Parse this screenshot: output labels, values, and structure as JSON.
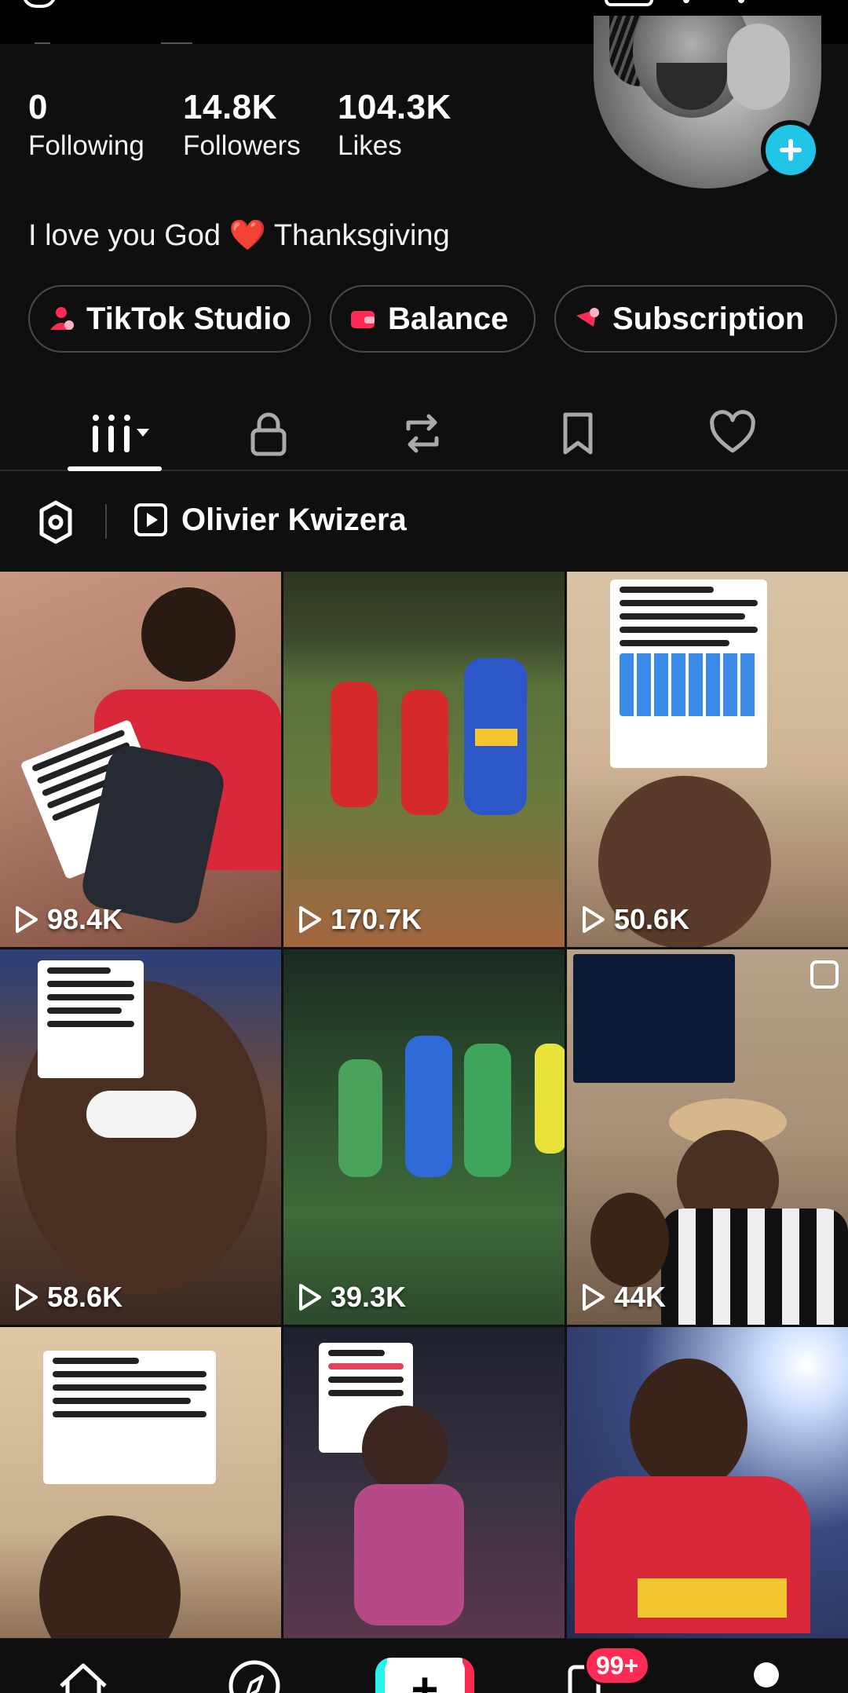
{
  "profile": {
    "stats": [
      {
        "value": "0",
        "label": "Following"
      },
      {
        "value": "14.8K",
        "label": "Followers"
      },
      {
        "value": "104.3K",
        "label": "Likes"
      }
    ],
    "bio_text": "I love you God",
    "bio_emoji": "❤️",
    "bio_suffix": "Thanksgiving"
  },
  "chips": [
    {
      "label": "TikTok Studio",
      "icon": "studio-icon"
    },
    {
      "label": "Balance",
      "icon": "wallet-icon"
    },
    {
      "label": "Subscription",
      "icon": "subscription-icon"
    }
  ],
  "tabs": [
    {
      "icon": "videos-grid-icon",
      "selected": true
    },
    {
      "icon": "lock-icon"
    },
    {
      "icon": "repost-icon"
    },
    {
      "icon": "bookmark-icon"
    },
    {
      "icon": "heart-icon"
    }
  ],
  "filter": {
    "playlist_name": "Olivier Kwizera"
  },
  "videos": [
    {
      "views": "98.4K"
    },
    {
      "views": "170.7K"
    },
    {
      "views": "50.6K"
    },
    {
      "views": "58.6K"
    },
    {
      "views": "39.3K"
    },
    {
      "views": "44K"
    },
    {
      "views": "",
      "hidden": true
    },
    {
      "views": "",
      "hidden": true
    },
    {
      "views": "",
      "hidden": true
    }
  ],
  "bottom_nav": {
    "inbox_badge": "99+",
    "items": [
      "home-icon",
      "discover-icon",
      "create-button",
      "inbox-icon",
      "profile-icon"
    ]
  },
  "colors": {
    "background": "#0f0f0f",
    "accent_cyan": "#20c5e8",
    "badge_red": "#fe2c55"
  }
}
